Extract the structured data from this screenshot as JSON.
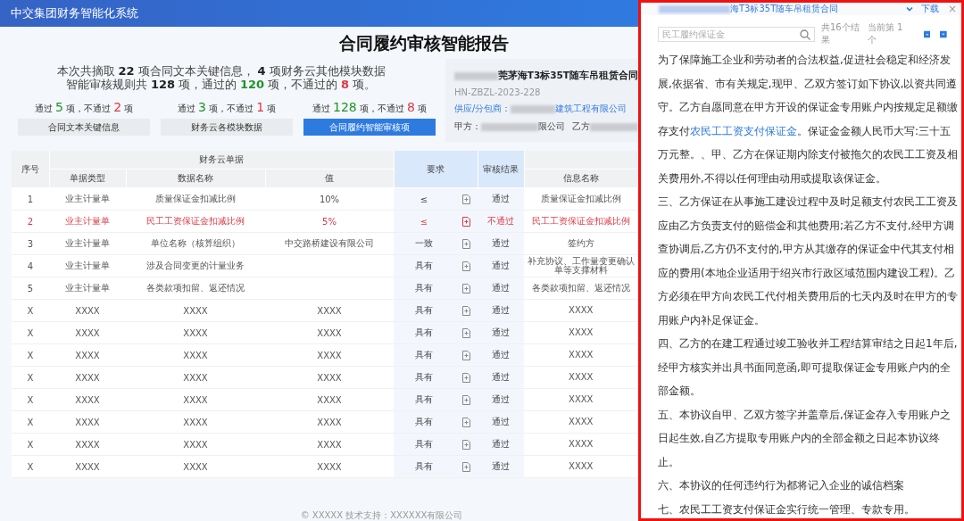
{
  "app_bar": {
    "title": "中交集团财务智能化系统"
  },
  "report": {
    "title": "合同履约审核智能报告",
    "summary": [
      [
        "本次共摘取 ",
        "22",
        " 项合同文本关键信息， ",
        "4",
        " 项财务云其他模块数据"
      ],
      [
        "智能审核规则共 ",
        "128",
        " 项，通过的 ",
        "120",
        " 项，不通过的 ",
        "8",
        " 项。"
      ]
    ],
    "stats": [
      {
        "pass_label": "通过",
        "pass": "5",
        "mid": "项，不通过",
        "fail": "2",
        "unit": "项",
        "button": "合同文本关键信息",
        "selected": false
      },
      {
        "pass_label": "通过",
        "pass": "3",
        "mid": "项，不通过",
        "fail": "1",
        "unit": "项",
        "button": "财务云各模块数据",
        "selected": false
      },
      {
        "pass_label": "通过",
        "pass": "128",
        "mid": "项，不通过",
        "fail": "8",
        "unit": "项",
        "button": "合同履约智能审核项",
        "selected": true
      }
    ],
    "contract": {
      "title": "莞茅海T3标35T随车吊租赁合同",
      "code": "HN-ZBZL-2023-228",
      "supplier_label": "供应/分包商：",
      "supplier": "建筑工程有限公司",
      "party_a_label": "甲方：",
      "party_a": "限公司",
      "party_b_label": "乙方"
    }
  },
  "table": {
    "group_header": "财务云单据",
    "columns": [
      "序号",
      "单据类型",
      "数据名称",
      "值",
      "要求",
      "审核结果",
      "信息名称"
    ],
    "rows": [
      {
        "no": "1",
        "type": "业主计量单",
        "name": "质量保证金扣减比例",
        "value": "10%",
        "req": "≤",
        "result": "通过",
        "passed": true,
        "info": "质量保证金扣减比例"
      },
      {
        "no": "2",
        "type": "业主计量单",
        "name": "民工工资保证金扣减比例",
        "value": "5%",
        "req": "≤",
        "result": "不通过",
        "passed": false,
        "info": "民工工资保证金扣减比例"
      },
      {
        "no": "3",
        "type": "业主计量单",
        "name": "单位名称（核算组织）",
        "value": "中交路桥建设有限公司",
        "req": "一致",
        "result": "通过",
        "passed": true,
        "info": "签约方"
      },
      {
        "no": "4",
        "type": "业主计量单",
        "name": "涉及合同变更的计量业务",
        "value": "",
        "req": "具有",
        "result": "通过",
        "passed": true,
        "info": "补充协议、工作量变更确认单等支撑材料"
      },
      {
        "no": "5",
        "type": "业主计量单",
        "name": "各类款项扣留、返还情况",
        "value": "",
        "req": "具有",
        "result": "通过",
        "passed": true,
        "info": "各类款项扣留、返还情况"
      },
      {
        "no": "X",
        "type": "XXXX",
        "name": "XXXX",
        "value": "XXXX",
        "req": "具有",
        "result": "通过",
        "passed": true,
        "info": "XXXX"
      },
      {
        "no": "X",
        "type": "XXXX",
        "name": "XXXX",
        "value": "XXXX",
        "req": "具有",
        "result": "通过",
        "passed": true,
        "info": "XXXX"
      },
      {
        "no": "X",
        "type": "XXXX",
        "name": "XXXX",
        "value": "XXXX",
        "req": "具有",
        "result": "通过",
        "passed": true,
        "info": "XXXX"
      },
      {
        "no": "X",
        "type": "XXXX",
        "name": "XXXX",
        "value": "XXXX",
        "req": "具有",
        "result": "通过",
        "passed": true,
        "info": "XXXX"
      },
      {
        "no": "X",
        "type": "XXXX",
        "name": "XXXX",
        "value": "XXXX",
        "req": "具有",
        "result": "通过",
        "passed": true,
        "info": "XXXX"
      },
      {
        "no": "X",
        "type": "XXXX",
        "name": "XXXX",
        "value": "XXXX",
        "req": "具有",
        "result": "通过",
        "passed": true,
        "info": "XXXX"
      },
      {
        "no": "X",
        "type": "XXXX",
        "name": "XXXX",
        "value": "XXXX",
        "req": "具有",
        "result": "通过",
        "passed": true,
        "info": "XXXX"
      },
      {
        "no": "X",
        "type": "XXXX",
        "name": "XXXX",
        "value": "XXXX",
        "req": "具有",
        "result": "通过",
        "passed": true,
        "info": "XXXX"
      }
    ]
  },
  "footer": "© XXXXX    技术支持：XXXXXX有限公司",
  "document_panel": {
    "title": "海T3标35T随车吊租赁合同",
    "download": "下载",
    "close": "×",
    "search": {
      "placeholder": "民工履约保证金",
      "results": "共16个结果",
      "current": "当前第 1 个"
    },
    "paragraphs": [
      [
        {
          "text": "为了保障施工企业和劳动者的合法权益,促进社会稳定和经济发展,依据省、市有关规定,现甲、乙双方签订如下协议,以资共同遵守。乙方自愿同意在甲方开设的保证金专用账户内按规定足额缴存支付",
          "highlighted": false
        },
        {
          "text": "农民工工资支付保证金",
          "highlighted": true
        },
        {
          "text": "。保证金金额人民币大写:三十五万元整。、甲、乙方在保证期内除支付被拖欠的农民工工资及相关费用外,不得以任何理由动用或提取该保证金。",
          "highlighted": false
        }
      ],
      [
        {
          "text": "三、乙方保证在从事施工建设过程中及时足额支付农民工工资及应由乙方负责支付的赔偿金和其他费用;若乙方不支付,经甲方调查协调后,乙方仍不支付的,甲方从其缴存的保证金中代其支付相应的费用(本地企业适用于绍兴市行政区域范围内建设工程)。乙方必须在甲方向农民工代付相关费用后的七天内及时在甲方的专用账户内补足保证金。",
          "highlighted": false
        }
      ],
      [
        {
          "text": "四、乙方的在建工程通过竣工验收并工程结算审结之日起1年后,经甲方核实并出具书面同意函,即可提取保证金专用账户内的全部金额。",
          "highlighted": false
        }
      ],
      [
        {
          "text": "五、本协议自甲、乙双方签字并盖章后,保证金存入专用账户之日起生效,自乙方提取专用账户内的全部金额之日起本协议终止。",
          "highlighted": false
        }
      ],
      [
        {
          "text": "六、本协议的任何违约行为都将记入企业的诚信档案",
          "highlighted": false
        }
      ],
      [
        {
          "text": "七、农民工工资支付保证金实行统一管理、专款专用。",
          "highlighted": false
        }
      ]
    ]
  }
}
